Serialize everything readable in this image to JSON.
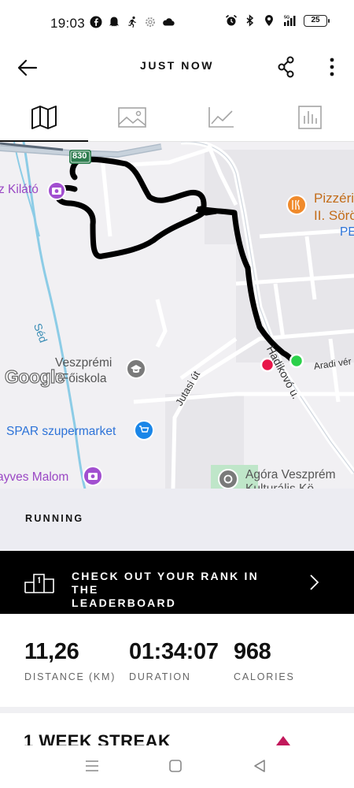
{
  "status_bar": {
    "time": "19:03",
    "battery": "25",
    "left_icons": [
      "facebook-icon",
      "ghost-icon",
      "runner-icon",
      "settings-icon",
      "cloud-icon"
    ],
    "right_icons": [
      "alarm-icon",
      "bluetooth-icon",
      "location-icon",
      "signal-icon",
      "battery-icon"
    ]
  },
  "header": {
    "title": "JUST NOW",
    "back_icon": "arrow-left-icon",
    "share_icon": "share-icon",
    "more_icon": "more-vertical-icon"
  },
  "tabs": [
    {
      "icon": "map-icon",
      "active": true
    },
    {
      "icon": "image-icon",
      "active": false
    },
    {
      "icon": "line-chart-icon",
      "active": false
    },
    {
      "icon": "bar-chart-icon",
      "active": false
    }
  ],
  "map": {
    "labels": {
      "kilato": "z Kilátó",
      "pizzeria_1": "Pizzéri",
      "pizzeria_2": "II. Sörö",
      "pe": "PE",
      "sed": "Séd",
      "veszpremi_1": "Veszprémi",
      "veszpremi_2": "i Főiskola",
      "spar": "SPAR szupermarket",
      "malom": "ayves Malom",
      "agora_1": "Agóra Veszprém",
      "agora_2": "Kulturális Kö",
      "road_830": "830",
      "jutasi": "Jutasi út",
      "hadikovo": "Hadikovó u.",
      "aradi": "Aradi vér",
      "google": "Google"
    },
    "colors": {
      "route": "#000000",
      "start_marker": "#2bd14a",
      "end_marker": "#e8174a",
      "poi_purple": "#a24fd0",
      "poi_blue": "#1a86e8",
      "poi_orange": "#f08a2b",
      "poi_gray": "#7a7a7a"
    }
  },
  "activity_type": "RUNNING",
  "leaderboard": {
    "line1": "CHECK OUT YOUR RANK IN THE",
    "line2": "LEADERBOARD",
    "icon": "podium-icon",
    "chevron_icon": "chevron-right-icon"
  },
  "stats": [
    {
      "value": "11,26",
      "label": "DISTANCE (KM)"
    },
    {
      "value": "01:34:07",
      "label": "DURATION"
    },
    {
      "value": "968",
      "label": "CALORIES"
    }
  ],
  "streak": {
    "title": "1 WEEK STREAK",
    "arrow_icon": "triangle-up-icon",
    "arrow_color": "#c2185b"
  },
  "nav_bar": {
    "icons": [
      "menu-icon",
      "home-square-icon",
      "back-triangle-icon"
    ]
  }
}
